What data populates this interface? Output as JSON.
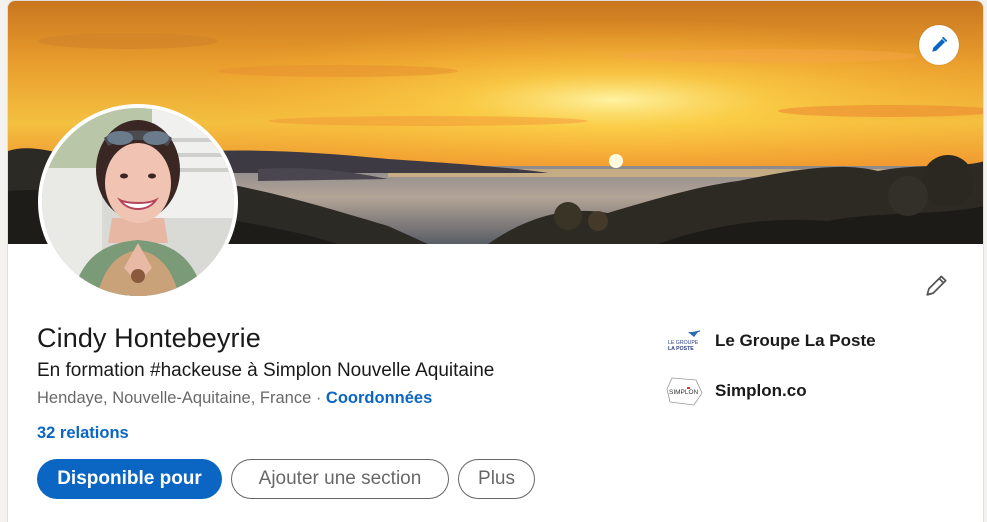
{
  "profile": {
    "name": "Cindy Hontebeyrie",
    "headline": "En formation #hackeuse à Simplon Nouvelle Aquitaine",
    "location": "Hendaye, Nouvelle-Aquitaine, France",
    "separator": " · ",
    "contact_link": "Coordonnées",
    "connections": "32 relations"
  },
  "actions": {
    "primary": "Disponible pour",
    "add_section": "Ajouter une section",
    "more": "Plus"
  },
  "organizations": [
    {
      "name": "Le Groupe La Poste",
      "logo_icon": "la-poste-logo",
      "logo_text_1": "LE GROUPE",
      "logo_text_2": "LA POSTE"
    },
    {
      "name": "Simplon.co",
      "logo_icon": "simplon-logo",
      "logo_text": "SIMPLON"
    }
  ],
  "icons": {
    "banner_edit": "pencil-icon",
    "intro_edit": "pencil-icon"
  },
  "colors": {
    "accent": "#0a66c2",
    "text_primary": "#191919",
    "text_secondary": "#666666",
    "simplon_red": "#e7302a"
  }
}
